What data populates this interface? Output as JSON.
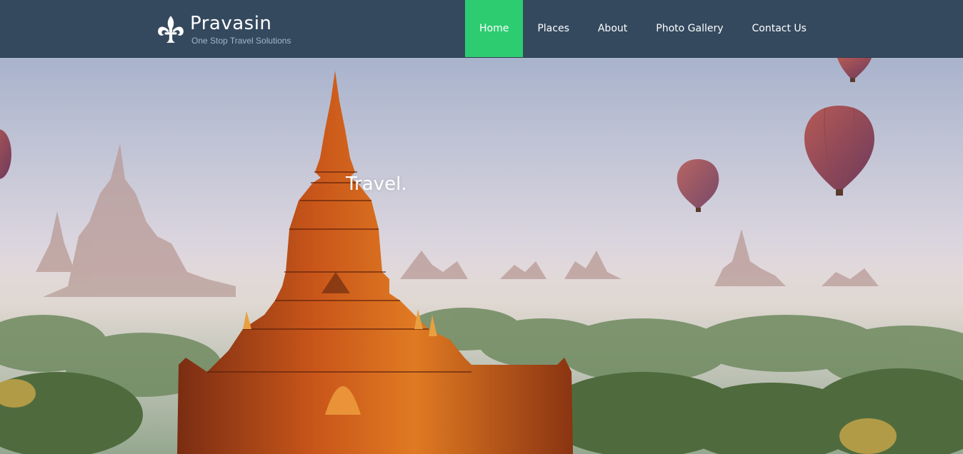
{
  "brand": {
    "name": "Pravasin",
    "tagline": "One Stop Travel Solutions",
    "logo_icon": "fleur-de-lis-icon"
  },
  "nav": {
    "items": [
      {
        "label": "Home",
        "active": true
      },
      {
        "label": "Places",
        "active": false
      },
      {
        "label": "About",
        "active": false
      },
      {
        "label": "Photo Gallery",
        "active": false
      },
      {
        "label": "Contact Us",
        "active": false
      }
    ]
  },
  "hero": {
    "caption": "Travel."
  },
  "colors": {
    "navbar_bg": "#34495e",
    "active_nav_bg": "#2ecc71",
    "tagline": "#9fb6cc"
  }
}
